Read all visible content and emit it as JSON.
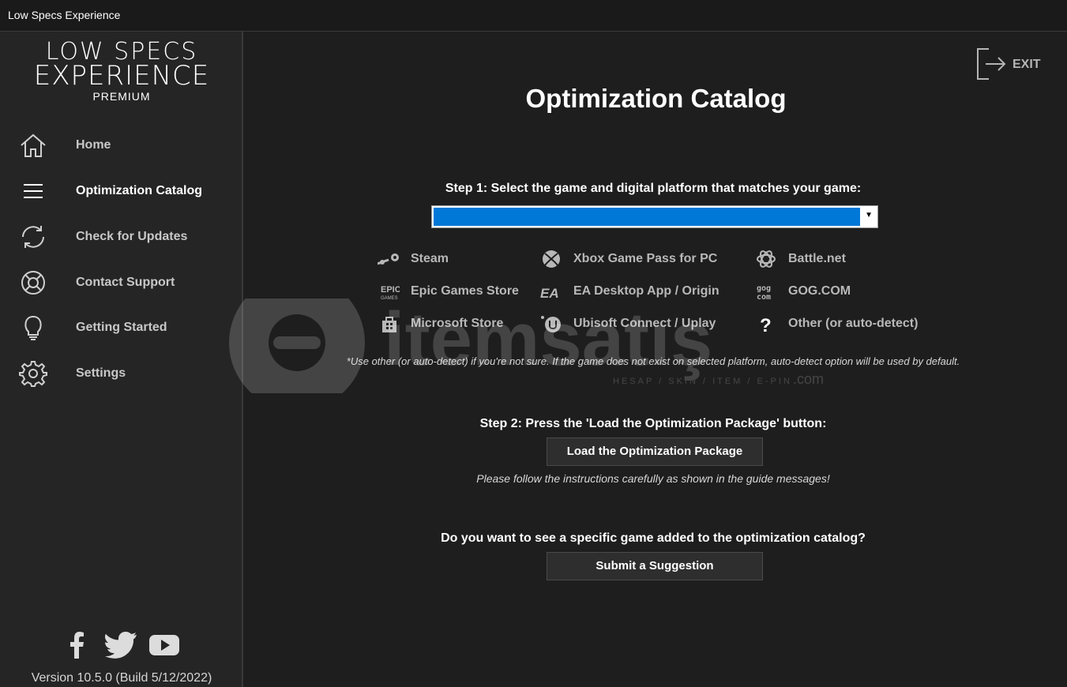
{
  "window": {
    "title": "Low Specs Experience"
  },
  "logo": {
    "line1": "LOW SPECS",
    "line2": "EXPERIENCE",
    "line3": "PREMIUM"
  },
  "nav": [
    {
      "label": "Home",
      "icon": "home-icon",
      "active": false
    },
    {
      "label": "Optimization Catalog",
      "icon": "menu-icon",
      "active": true
    },
    {
      "label": "Check for Updates",
      "icon": "refresh-icon",
      "active": false
    },
    {
      "label": "Contact Support",
      "icon": "lifebuoy-icon",
      "active": false
    },
    {
      "label": "Getting Started",
      "icon": "lightbulb-icon",
      "active": false
    },
    {
      "label": "Settings",
      "icon": "gear-icon",
      "active": false
    }
  ],
  "social": [
    "facebook-icon",
    "twitter-icon",
    "youtube-icon"
  ],
  "version": "Version 10.5.0 (Build 5/12/2022)",
  "exit": {
    "label": "EXIT"
  },
  "main": {
    "title": "Optimization Catalog",
    "step1": "Step 1: Select the game and digital platform that matches your game:",
    "select": {
      "value": "",
      "highlight_color": "#0078d7"
    },
    "platforms": [
      {
        "label": "Steam",
        "icon": "steam-icon"
      },
      {
        "label": "Xbox Game Pass for PC",
        "icon": "xbox-icon"
      },
      {
        "label": "Battle.net",
        "icon": "battlenet-icon"
      },
      {
        "label": "Epic Games Store",
        "icon": "epic-games-icon"
      },
      {
        "label": "EA Desktop App / Origin",
        "icon": "ea-icon"
      },
      {
        "label": "GOG.COM",
        "icon": "gog-icon"
      },
      {
        "label": "Microsoft Store",
        "icon": "microsoft-store-icon"
      },
      {
        "label": "Ubisoft Connect / Uplay",
        "icon": "ubisoft-icon"
      },
      {
        "label": "Other (or auto-detect)",
        "icon": "question-icon"
      }
    ],
    "note": "*Use other (or auto-detect) if you're not sure. If the game does not exist on selected platform, auto-detect option will be used by default.",
    "step2": "Step 2: Press the 'Load the Optimization Package' button:",
    "load_button": "Load the Optimization Package",
    "hint": "Please follow the instructions carefully as shown in the guide messages!",
    "question": "Do you want to see a specific game added to the optimization catalog?",
    "suggest_button": "Submit a Suggestion"
  },
  "watermark": {
    "brand": "itemsatış",
    "tagline": "HESAP / SKIN / ITEM / E-PIN",
    "suffix": ".com"
  }
}
